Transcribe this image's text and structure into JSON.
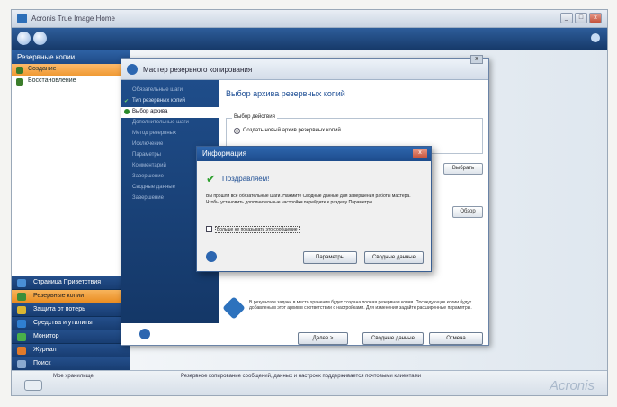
{
  "window": {
    "title": "Acronis True Image Home",
    "controls": [
      "_",
      "□",
      "x"
    ]
  },
  "left_panel": {
    "header": "Резервные копии",
    "items": [
      {
        "label": "Создание",
        "active": true,
        "color": "#3b7d2b"
      },
      {
        "label": "Восстановление",
        "active": false,
        "color": "#3b7d2b"
      }
    ],
    "nav": [
      {
        "label": "Страница Приветствия",
        "active": false,
        "color": "#4a8fd6"
      },
      {
        "label": "Резервные копии",
        "active": true,
        "color": "#3c8e3a"
      },
      {
        "label": "Защита от потерь",
        "active": false,
        "color": "#d9b632"
      },
      {
        "label": "Средства и утилиты",
        "active": false,
        "color": "#2f7fd1"
      },
      {
        "label": "Монитор",
        "active": false,
        "color": "#49b04a"
      },
      {
        "label": "Журнал",
        "active": false,
        "color": "#e07a2a"
      },
      {
        "label": "Поиск",
        "active": false,
        "color": "#8aa9cf"
      }
    ]
  },
  "wizard": {
    "title": "Мастер резервного копирования",
    "steps": [
      {
        "label": "Обязательные шаги",
        "state": "header"
      },
      {
        "label": "Тип резервных копий",
        "state": "done"
      },
      {
        "label": "Выбор архива",
        "state": "current"
      },
      {
        "label": "Дополнительные шаги",
        "state": "header"
      },
      {
        "label": "Метод резервных",
        "state": "pending"
      },
      {
        "label": "Исключение",
        "state": "pending"
      },
      {
        "label": "Параметры",
        "state": "pending"
      },
      {
        "label": "Комментарий",
        "state": "pending"
      },
      {
        "label": "Завершение",
        "state": "pending"
      },
      {
        "label": "Сводные данные",
        "state": "header"
      },
      {
        "label": "Завершение",
        "state": "pending"
      }
    ],
    "heading": "Выбор архива резервных копий",
    "group_label": "Выбор действия",
    "radio_label": "Создать новый архив резервных копий",
    "browse_label": "Выбрать",
    "browse2_label": "Обзор",
    "info_text": "В результате задачи в место хранения будет создана полная резервная копия. Последующие копии будут добавлены в этот архив в соответствии с настройками. Для изменения задайте расширенные параметры.",
    "buttons": {
      "next": "Далее >",
      "summary": "Сводные данные",
      "cancel": "Отмена"
    }
  },
  "dialog": {
    "title": "Информация",
    "congrats": "Поздравляем!",
    "text": "Вы прошли все обязательные шаги. Нажмите Сводные данные для завершения работы мастера. Чтобы установить дополнительные настройки перейдите к разделу Параметры.",
    "checkbox_label": "Больше не показывать это сообщение",
    "buttons": {
      "params": "Параметры",
      "summary": "Сводные данные"
    }
  },
  "status": {
    "drive_label": "Мое хранилище",
    "message": "Резервное копирование сообщений, данных и настроек поддерживается почтовыми клиентами",
    "brand": "Acronis"
  }
}
